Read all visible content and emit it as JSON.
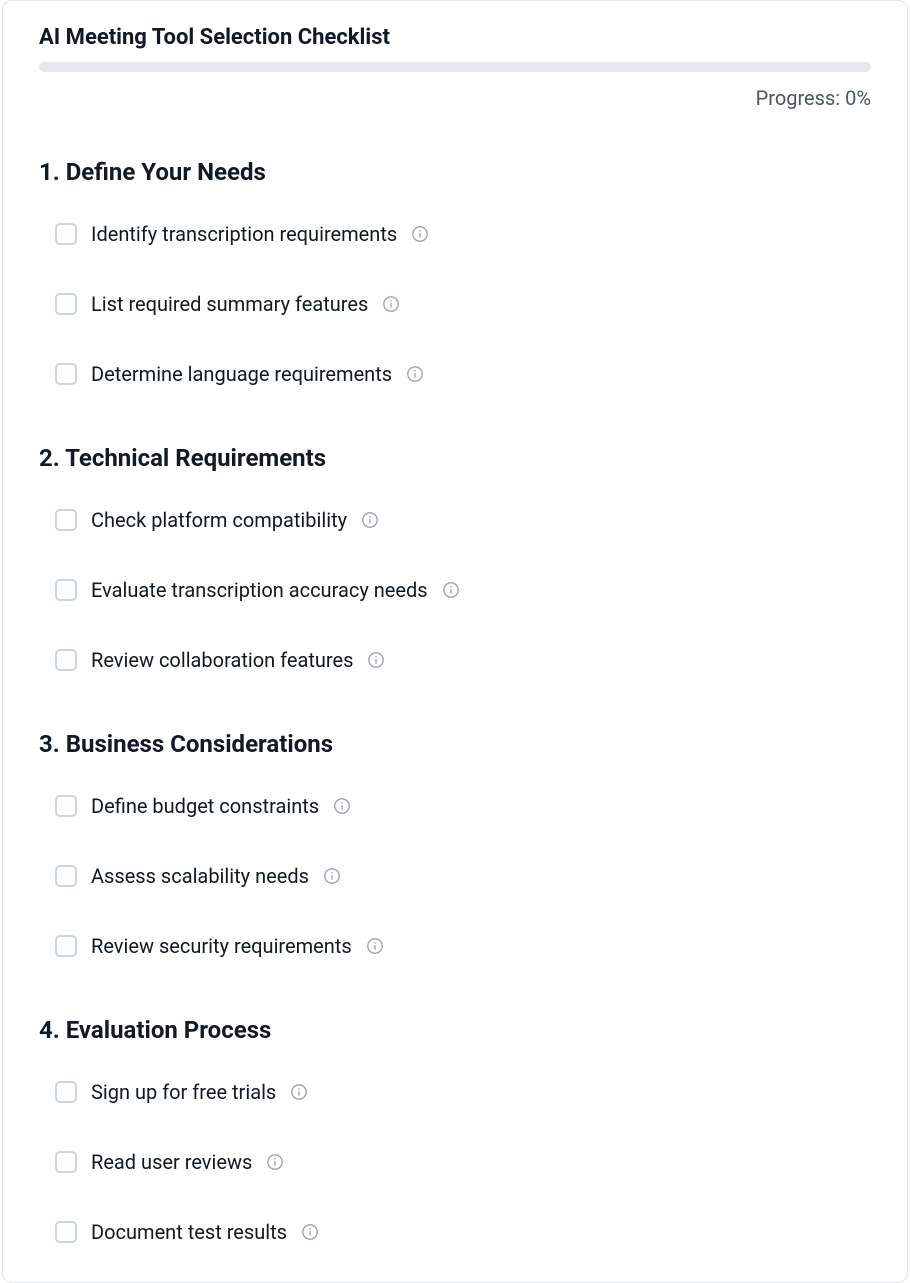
{
  "title": "AI Meeting Tool Selection Checklist",
  "progress": {
    "label": "Progress: 0%",
    "percent": 0
  },
  "sections": [
    {
      "title": "1. Define Your Needs",
      "items": [
        {
          "label": "Identify transcription requirements"
        },
        {
          "label": "List required summary features"
        },
        {
          "label": "Determine language requirements"
        }
      ]
    },
    {
      "title": "2. Technical Requirements",
      "items": [
        {
          "label": "Check platform compatibility"
        },
        {
          "label": "Evaluate transcription accuracy needs"
        },
        {
          "label": "Review collaboration features"
        }
      ]
    },
    {
      "title": "3. Business Considerations",
      "items": [
        {
          "label": "Define budget constraints"
        },
        {
          "label": "Assess scalability needs"
        },
        {
          "label": "Review security requirements"
        }
      ]
    },
    {
      "title": "4. Evaluation Process",
      "items": [
        {
          "label": "Sign up for free trials"
        },
        {
          "label": "Read user reviews"
        },
        {
          "label": "Document test results"
        }
      ]
    }
  ]
}
